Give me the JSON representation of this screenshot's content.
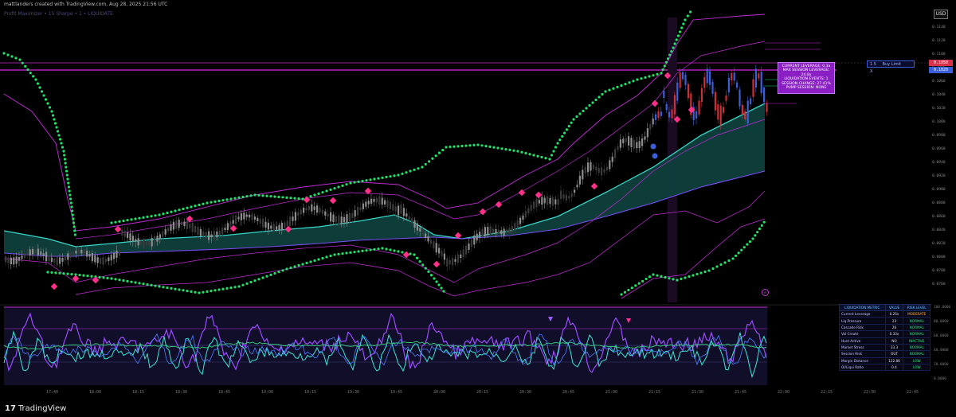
{
  "header": {
    "credit": "mattlanders created with TradingView.com, Aug 28, 2025 21:56 UTC",
    "indicator": "Profit Maximizer • 15 Sharpe • 1 • LIQUIDATE"
  },
  "currency_badge": "USD",
  "price_axis": {
    "labels": [
      "0.1140",
      "0.1120",
      "0.1100",
      "0.1080",
      "0.1060",
      "0.1040",
      "0.1020",
      "0.1000",
      "0.0980",
      "0.0960",
      "0.0940",
      "0.0920",
      "0.0900",
      "0.0880",
      "0.0860",
      "0.0840",
      "0.0820",
      "0.0800",
      "0.0780",
      "0.0760"
    ],
    "tag_current": "0.1050",
    "tag_secondary": "0.1020"
  },
  "time_axis": {
    "labels": [
      "17:40",
      "18:00",
      "18:15",
      "18:30",
      "18:45",
      "19:00",
      "19:15",
      "19:30",
      "19:45",
      "20:00",
      "20:15",
      "20:30",
      "20:45",
      "21:00",
      "21:15",
      "21:30",
      "21:45",
      "22:00",
      "22:15",
      "22:30",
      "22:45"
    ]
  },
  "session_box": {
    "lines": [
      "CURRENT LEVERAGE: 0.3x",
      "MAX SESSION LEVERAGE: 24.8x",
      "LIQUIDATION EVENTS: 1",
      "SESSION CHANGE: 27.41%",
      "PUMP SESSION: NONE"
    ]
  },
  "order_box": {
    "qty": "1.5",
    "label": "Buy Limit",
    "close": "X"
  },
  "liquidation_table": {
    "headers": [
      "LIQUIDATION METRIC",
      "VALUE",
      "RISK LEVEL"
    ],
    "rows": [
      {
        "metric": "Current Leverage",
        "value": "0.25x",
        "risk": "MODERATE",
        "color": "#ffb13b"
      },
      {
        "metric": "Liq Pressure",
        "value": "23",
        "risk": "NORMAL",
        "color": "#3be07a"
      },
      {
        "metric": "Cascade Risk",
        "value": "26",
        "risk": "NORMAL",
        "color": "#3be07a"
      },
      {
        "metric": "Vol Create",
        "value": "0.33x",
        "risk": "NORMAL",
        "color": "#3be07a"
      },
      {
        "metric": "Hunt Active",
        "value": "NO",
        "risk": "INACTIVE",
        "color": "#3be07a"
      },
      {
        "metric": "Market Stress",
        "value": "33.3",
        "risk": "NORMAL",
        "color": "#3be07a"
      },
      {
        "metric": "Session Risk",
        "value": "OUT",
        "risk": "NORMAL",
        "color": "#3be07a"
      },
      {
        "metric": "Margin Distance",
        "value": "122.86",
        "risk": "LOW",
        "color": "#3be07a"
      },
      {
        "metric": "OI/Liqui Ratio",
        "value": "0.4",
        "risk": "LOW",
        "color": "#3be07a"
      }
    ]
  },
  "osc_axis": {
    "labels": [
      "100.0000",
      "80.0000",
      "60.0000",
      "40.0000",
      "20.0000",
      "0.0000"
    ]
  },
  "footer": {
    "brand": "TradingView",
    "logo_mark": "17"
  },
  "colors": {
    "bull": "#2e2e2e",
    "bear": "#8b8b8b",
    "red_candle": "#c8303a",
    "blue_candle": "#3a5fd9",
    "band": "#c22bd6",
    "sar": "#22e06a",
    "cloud": "#0f4a47",
    "signal": "#ff2f8a"
  }
}
